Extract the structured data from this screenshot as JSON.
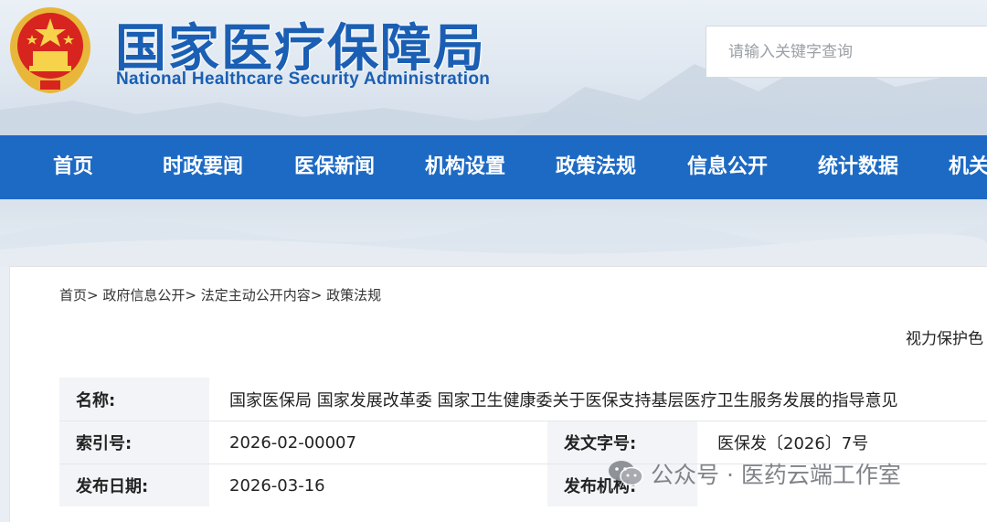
{
  "header": {
    "title_cn": "国家医疗保障局",
    "title_en": "National Healthcare Security Administration",
    "emblem_icon": "national-emblem-icon"
  },
  "search": {
    "placeholder": "请输入关键字查询"
  },
  "nav": {
    "items": [
      {
        "label": "首页"
      },
      {
        "label": "时政要闻"
      },
      {
        "label": "医保新闻"
      },
      {
        "label": "机构设置"
      },
      {
        "label": "政策法规"
      },
      {
        "label": "信息公开"
      },
      {
        "label": "统计数据"
      },
      {
        "label": "机关"
      }
    ]
  },
  "breadcrumb": {
    "items": [
      "首页",
      "政府信息公开",
      "法定主动公开内容",
      "政策法规"
    ],
    "separator": ">"
  },
  "vision_mode": "视力保护色",
  "document": {
    "name_label": "名称:",
    "name_value": "国家医保局 国家发展改革委 国家卫生健康委关于医保支持基层医疗卫生服务发展的指导意见",
    "index_label": "索引号:",
    "index_value": "2026-02-00007",
    "doc_no_label": "发文字号:",
    "doc_no_value": "医保发〔2026〕7号",
    "date_label": "发布日期:",
    "date_value": "2026-03-16",
    "issuer_label": "发布机构:",
    "issuer_value": ""
  },
  "watermark": {
    "text": "公众号 · 医药云端工作室",
    "icon": "wechat-icon"
  },
  "colors": {
    "brand_blue": "#1d6ac4",
    "title_blue": "#1a5fb4",
    "label_bg": "#f2f4f7"
  }
}
